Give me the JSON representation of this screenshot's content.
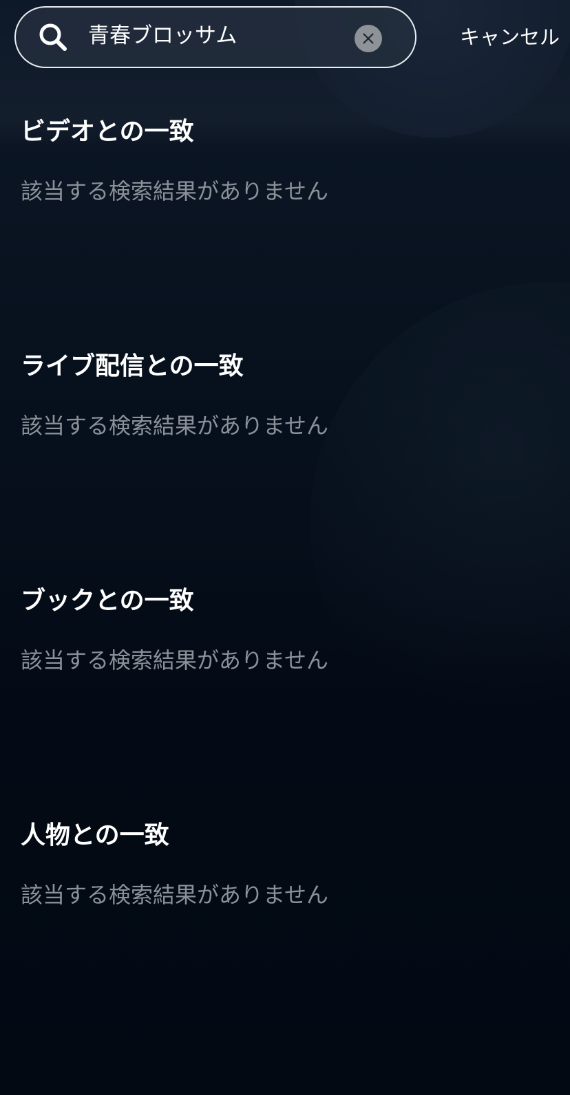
{
  "search": {
    "value": "青春ブロッサム",
    "cancel_label": "キャンセル"
  },
  "sections": [
    {
      "title": "ビデオとの一致",
      "empty_text": "該当する検索結果がありません"
    },
    {
      "title": "ライブ配信との一致",
      "empty_text": "該当する検索結果がありません"
    },
    {
      "title": "ブックとの一致",
      "empty_text": "該当する検索結果がありません"
    },
    {
      "title": "人物との一致",
      "empty_text": "該当する検索結果がありません"
    }
  ],
  "colors": {
    "background": "#020913",
    "search_border": "#e9edf2",
    "muted_text": "#8b9199",
    "clear_button": "#8e9299"
  },
  "icons": {
    "search": "search-icon",
    "clear": "close-icon"
  }
}
